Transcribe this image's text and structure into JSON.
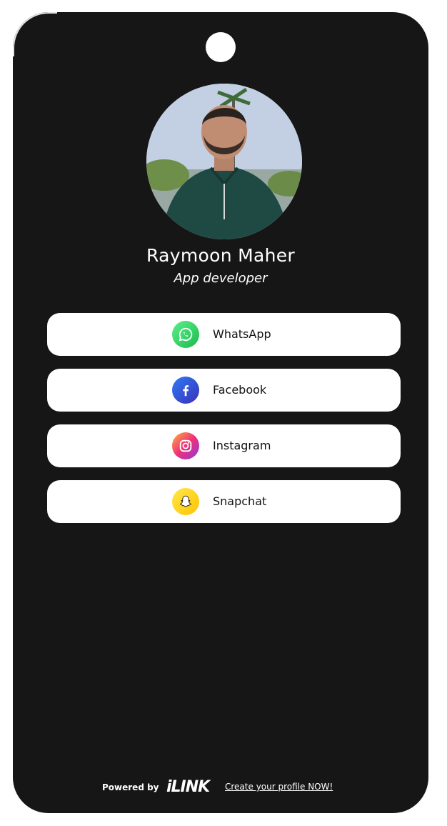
{
  "profile": {
    "name": "Raymoon Maher",
    "role": "App developer"
  },
  "links": [
    {
      "label": "WhatsApp",
      "icon": "whatsapp-icon",
      "color": "#25d366"
    },
    {
      "label": "Facebook",
      "icon": "facebook-icon",
      "color": "#1b4fd6"
    },
    {
      "label": "Instagram",
      "icon": "instagram-icon",
      "color": "#e1306c"
    },
    {
      "label": "Snapchat",
      "icon": "snapchat-icon",
      "color": "#ffd400"
    }
  ],
  "footer": {
    "powered_by": "Powered by",
    "logo": "iLINK",
    "cta": "Create your profile NOW!"
  },
  "colors": {
    "card_bg": "#161616",
    "page_bg": "#ffffff",
    "button_bg": "#ffffff"
  }
}
